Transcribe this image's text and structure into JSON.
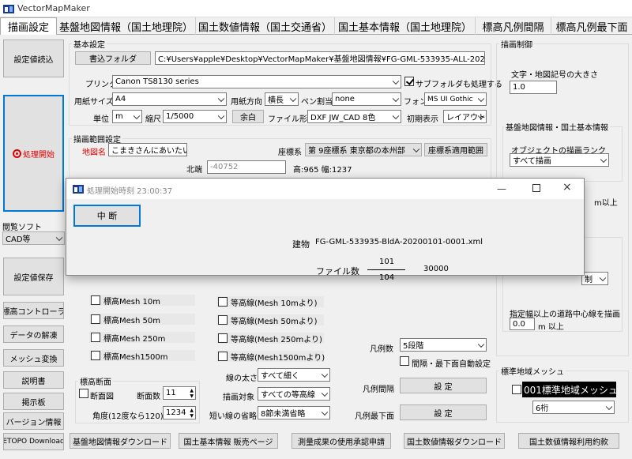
{
  "window": {
    "title": "VectorMapMaker"
  },
  "tabs": [
    "描画設定",
    "基盤地図情報（国土地理院）",
    "国土数値情報（国土交通省）",
    "国土基本情報（国土地理院）",
    "標高凡例間隔",
    "標高凡例最下面"
  ],
  "left": {
    "load_settings": "設定値読込",
    "process_start": "処理開始",
    "viewer_label": "閲覧ソフト",
    "viewer_value": "CAD等",
    "save_settings": "設定値保存",
    "buttons": [
      "標高コントローラ",
      "データの解凍",
      "メッシュ変換",
      "説明書",
      "掲示板",
      "バージョン情報",
      "ETOPO Download"
    ]
  },
  "basic": {
    "group_title": "基本設定",
    "output_folder_btn": "書込フォルダ",
    "output_folder": "C:¥Users¥apple¥Desktop¥VectorMapMaker¥基盤地図情報¥FG-GML-533935-ALL-20200101",
    "printer_label": "プリンタ",
    "printer_value": "Canon TS8130 series",
    "subfolder_label": "サブフォルダも処理する",
    "paper_label": "用紙サイズ",
    "paper_value": "A4",
    "orient_label": "用紙方向",
    "orient_value": "横長",
    "pen_label": "ペン割当",
    "pen_value": "none",
    "font_label": "フォント",
    "font_value": "MS UI Gothic",
    "unit_label": "単位",
    "unit_value": "m",
    "scale_label": "縮尺",
    "scale_value": "1/5000",
    "margin_btn": "余白",
    "filetype_label": "ファイル形式",
    "filetype_value": "DXF JW_CAD 8色",
    "initial_label": "初期表示",
    "initial_value": "レイアウト"
  },
  "range": {
    "group_title": "描画範囲設定",
    "place_label": "地図名",
    "place_value": "こまきさんにあいたい",
    "coord_label": "座標系",
    "coord_value": "第 9座標系 東京都の本州部",
    "coord_btn": "座標系適用範囲",
    "north_label": "北端",
    "north_value": "-40752",
    "size_text": "高:965 幅:1237"
  },
  "elev": {
    "items": [
      "標高Mesh  10m",
      "標高Mesh  50m",
      "標高Mesh 250m",
      "標高Mesh1500m"
    ],
    "contours": [
      "等高線(Mesh  10mより)",
      "等高線(Mesh  50mより)",
      "等高線(Mesh 250mより)",
      "等高線(Mesh1500mより)"
    ],
    "section_group": "標高断面",
    "section_chk": "断面図",
    "section_count_label": "断面数",
    "section_count": "11",
    "angle_label": "角度(12度なら120)",
    "angle_value": "1234",
    "line_width_label": "線の太さ",
    "line_width_value": "すべて細く",
    "target_label": "描画対象",
    "target_value": "すべての等高線",
    "omit_label": "短い線の省略",
    "omit_value": "8節未満省略",
    "legend_count_label": "凡例数",
    "legend_count_value": "5段階",
    "interval_auto": "間隔・最下面自動設定",
    "legend_interval_label": "凡例間隔",
    "legend_bottom_label": "凡例最下面",
    "set_btn": "設 定"
  },
  "right": {
    "group_title": "描画制御",
    "font_size_label": "文字・地図記号の大きさ",
    "font_size_value": "1.0",
    "kiban_group": "基盤地図情報・国土基本情報",
    "rank_label": "オブジェクトの描画ランク",
    "rank_value": "すべて描画",
    "m_above": "m以上",
    "restrict_value": "制",
    "road_label": "指定幅以上の道路中心線を描画",
    "road_value": "0.0",
    "road_unit": "m 以上",
    "mesh_group": "標準地域メッシュ",
    "mesh_chk": "001標準地域メッシュ",
    "mesh_digits": "6桁"
  },
  "bottom_links": [
    "基盤地図情報ダウンロード",
    "国土基本情報 販売ページ",
    "測量成果の使用承認申請",
    "国土数値情報ダウンロード",
    "国土数値情報利用約款"
  ],
  "dialog": {
    "title": "処理開始時刻 23:00:37",
    "interrupt_btn": "中 断",
    "file_label": "建物",
    "file_name": "FG-GML-533935-BldA-20200101-0001.xml",
    "count_label": "ファイル数",
    "numerator": "101",
    "denominator": "104",
    "total": "30000"
  },
  "colors": {
    "accent": "#0078d7",
    "red": "#e00000"
  }
}
